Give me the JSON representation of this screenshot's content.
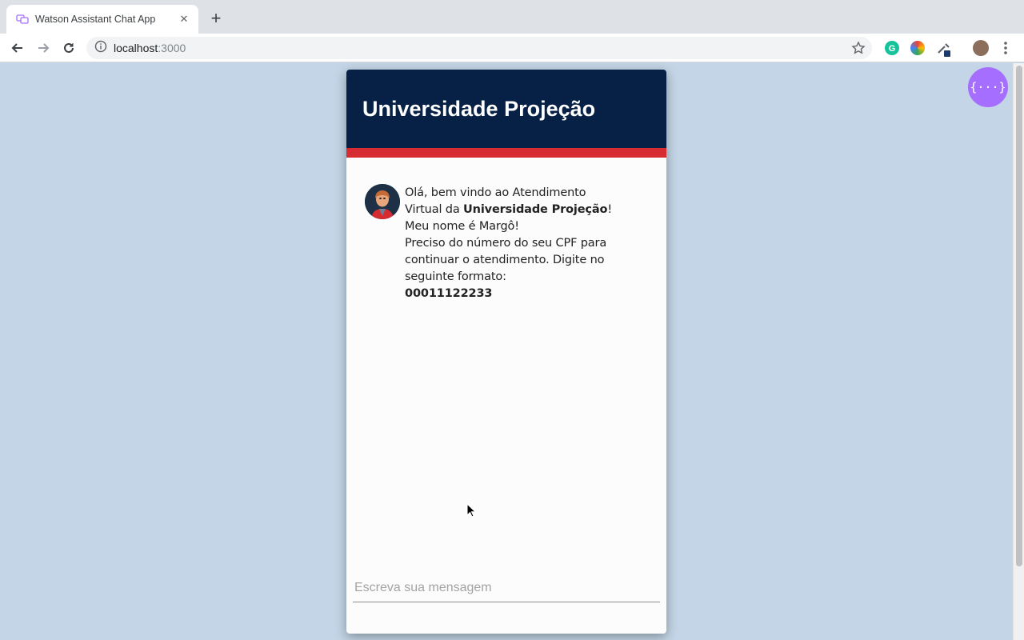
{
  "browser": {
    "tab_title": "Watson Assistant Chat App",
    "tab_close": "✕",
    "new_tab": "+",
    "url_host": "localhost",
    "url_port": ":3000"
  },
  "chat": {
    "title": "Universidade Projeção",
    "message": {
      "line1": "Olá, bem vindo ao Atendimento",
      "line2_prefix": "Virtual da ",
      "line2_bold": "Universidade Projeção",
      "line2_suffix": "!",
      "line3": "Meu nome é Margô!",
      "line4": "Preciso do número do seu CPF para",
      "line5": "continuar o atendimento. Digite no",
      "line6": "seguinte formato:",
      "line7_bold": "00011122233"
    },
    "input_placeholder": "Escreva sua mensagem"
  },
  "json_button": {
    "label": "{···}"
  },
  "colors": {
    "header": "#072046",
    "stripe": "#d62b31",
    "json_button": "#a56eff",
    "page_bg": "#c3d5e6"
  }
}
